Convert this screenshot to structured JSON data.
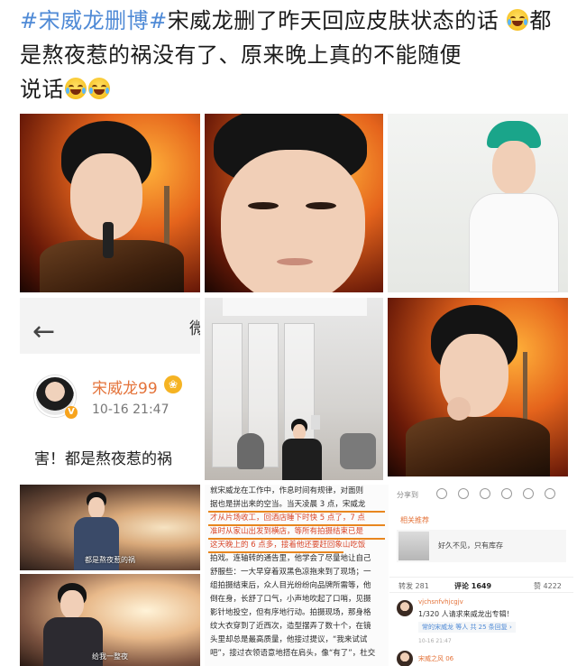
{
  "post": {
    "tag1": "#宋威龙删博#",
    "text_line1": "宋威龙删了昨天回应皮肤状态的话",
    "text_line2": "都是熬夜惹的祸没有了、原来晚上真的不能随便",
    "text_line3": "说话"
  },
  "weibo_card": {
    "back_glyph": "←",
    "title_partial": "微",
    "username": "宋威龙99",
    "badge_glyph": "❀",
    "verified_glyph": "V",
    "timestamp": "10-16 21:47",
    "body": "害！都是熬夜惹的祸"
  },
  "reply_panel": {
    "share_label": "分享到",
    "recommend_label": "相关推荐",
    "recommend_text": "好久不见，只有库存",
    "tabs": {
      "repost": "转发 281",
      "comments": "评论 1649",
      "likes": "赞 4222"
    },
    "comment_user": "vjchsnfvhjcgjv",
    "comment_text": "1/320 人请求来威龙出专辑！",
    "comment_sub": "常的宋威龙 等人 共 25 条回复 ›",
    "comment_time": "10-16 21:47",
    "comment2_user": "宋威之风 06"
  },
  "article": {
    "lines": [
      "就宋威龙在工作中，作息时间有规律，对面则",
      "据也是拼出来的空当。当天凌晨 3 点，宋威龙",
      "才从片场收工，回酒店睡下时快 5 点了，7 点",
      "准时从家山出发到横店，等所有拍摄结束已是",
      "这天晚上的 6 点多，接着他还要赶回象山吃饭",
      "拍戏。连轴转的通告里，他学会了尽量地让自己",
      "舒服些：一大早穿着双黑色凉拖来到了现场；一",
      "组拍摄结束后，众人目光纷纷向品牌所需等，他",
      "倒在身，长舒了口气，小声地吹起了口哨，见摄",
      "影针地投空，但有序地行动。拍摄现场，那身格",
      "纹大衣穿到了近西次，造型摆弄了数十个，在镜",
      "头里却总是最高质量，他接过提议，“我来试试",
      "吧”，接过衣领语意地搭在肩头，像“有了”，杜交"
    ],
    "highlight_line_indexes": [
      1,
      2,
      3,
      4
    ]
  },
  "stills": {
    "caption1": "都是熬夜惹的祸",
    "caption2": "给我一整夜"
  },
  "colors": {
    "hashtag": "#4f8ad6",
    "weibo_orange": "#e4733a",
    "underline": "#e8861f"
  }
}
